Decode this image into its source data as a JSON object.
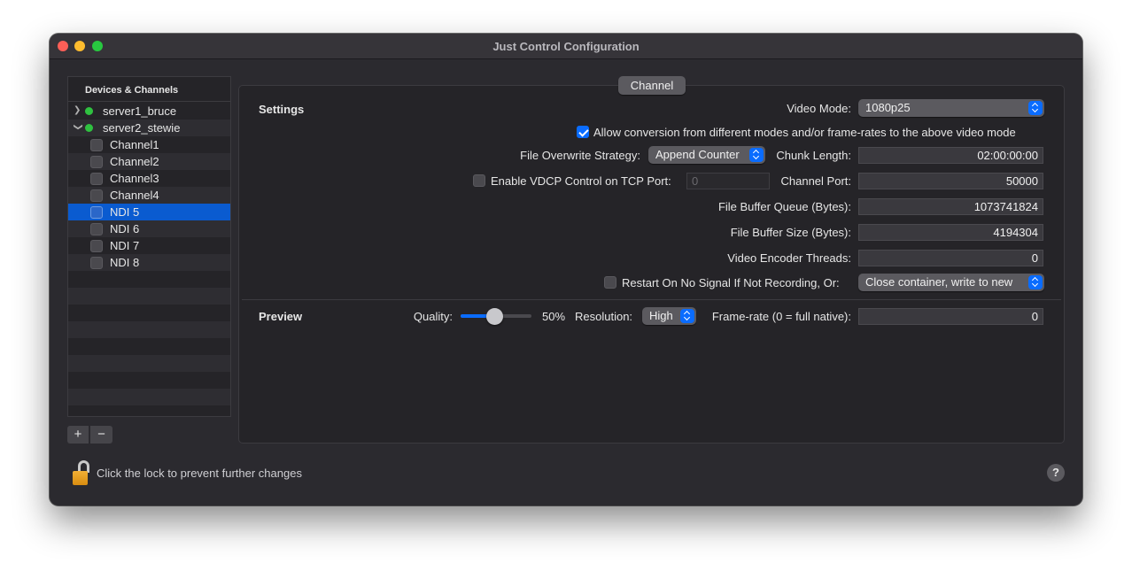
{
  "window": {
    "title": "Just Control Configuration"
  },
  "sidebar": {
    "header": "Devices & Channels",
    "servers": [
      {
        "label": "server1_bruce",
        "expanded": false,
        "status": "online"
      },
      {
        "label": "server2_stewie",
        "expanded": true,
        "status": "online"
      }
    ],
    "channels": [
      "Channel1",
      "Channel2",
      "Channel3",
      "Channel4",
      "NDI 5",
      "NDI 6",
      "NDI 7",
      "NDI 8"
    ],
    "selected": "NDI 5",
    "add_label": "+",
    "remove_label": "−"
  },
  "tab": {
    "label": "Channel"
  },
  "settings": {
    "section_label": "Settings",
    "video_mode_label": "Video Mode:",
    "video_mode_value": "1080p25",
    "allow_conversion_label": "Allow conversion from different modes and/or frame-rates to the above video mode",
    "allow_conversion_checked": true,
    "overwrite_label": "File Overwrite Strategy:",
    "overwrite_value": "Append Counter",
    "chunk_label": "Chunk Length:",
    "chunk_value": "02:00:00:00",
    "vdcp_label": "Enable VDCP Control on TCP Port:",
    "vdcp_checked": false,
    "vdcp_port_value": "0",
    "channel_port_label": "Channel Port:",
    "channel_port_value": "50000",
    "buffer_queue_label": "File Buffer Queue (Bytes):",
    "buffer_queue_value": "1073741824",
    "buffer_size_label": "File Buffer Size (Bytes):",
    "buffer_size_value": "4194304",
    "encoder_threads_label": "Video Encoder Threads:",
    "encoder_threads_value": "0",
    "restart_label": "Restart On No Signal If Not Recording, Or:",
    "restart_checked": false,
    "restart_value": "Close container, write to new"
  },
  "preview": {
    "section_label": "Preview",
    "quality_label": "Quality:",
    "quality_percent": 50,
    "quality_text": "50%",
    "resolution_label": "Resolution:",
    "resolution_value": "High",
    "framerate_label": "Frame-rate (0 = full native):",
    "framerate_value": "0"
  },
  "footer": {
    "lock_text": "Click the lock to prevent further changes",
    "help_label": "?"
  },
  "colors": {
    "accent": "#0a6cff",
    "selection": "#0a5bd0",
    "status_online": "#2fc140"
  }
}
